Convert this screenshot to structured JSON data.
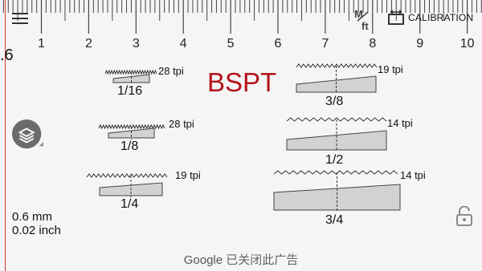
{
  "ruler": {
    "ticks": [
      "1",
      "2",
      "3",
      "4",
      "5",
      "6",
      "7",
      "8",
      "9",
      "10"
    ],
    "edge_value": ".6"
  },
  "toolbar": {
    "menu_icon": "hamburger-menu-icon",
    "unit_icon": "metric-feet-toggle-icon",
    "calibration_icon": "calibration-icon",
    "calibration_label": "CALIBRATION"
  },
  "title": "BSPT",
  "threads": [
    {
      "size": "1/16",
      "tpi": "28 tpi"
    },
    {
      "size": "1/8",
      "tpi": "28 tpi"
    },
    {
      "size": "1/4",
      "tpi": "19 tpi"
    },
    {
      "size": "3/8",
      "tpi": "19 tpi"
    },
    {
      "size": "1/2",
      "tpi": "14 tpi"
    },
    {
      "size": "3/4",
      "tpi": "14 tpi"
    }
  ],
  "readout": {
    "mm": "0.6 mm",
    "inch": "0.02 inch"
  },
  "side_icons": {
    "layers": "layers-icon",
    "lock": "unlock-icon"
  },
  "ad": {
    "brand": "Google",
    "text": "已关闭此广告"
  },
  "colors": {
    "title": "#b3141c",
    "edge_line": "#d83a3a",
    "background": "#f5f5f5",
    "thread_fill": "#d2d2d2"
  }
}
